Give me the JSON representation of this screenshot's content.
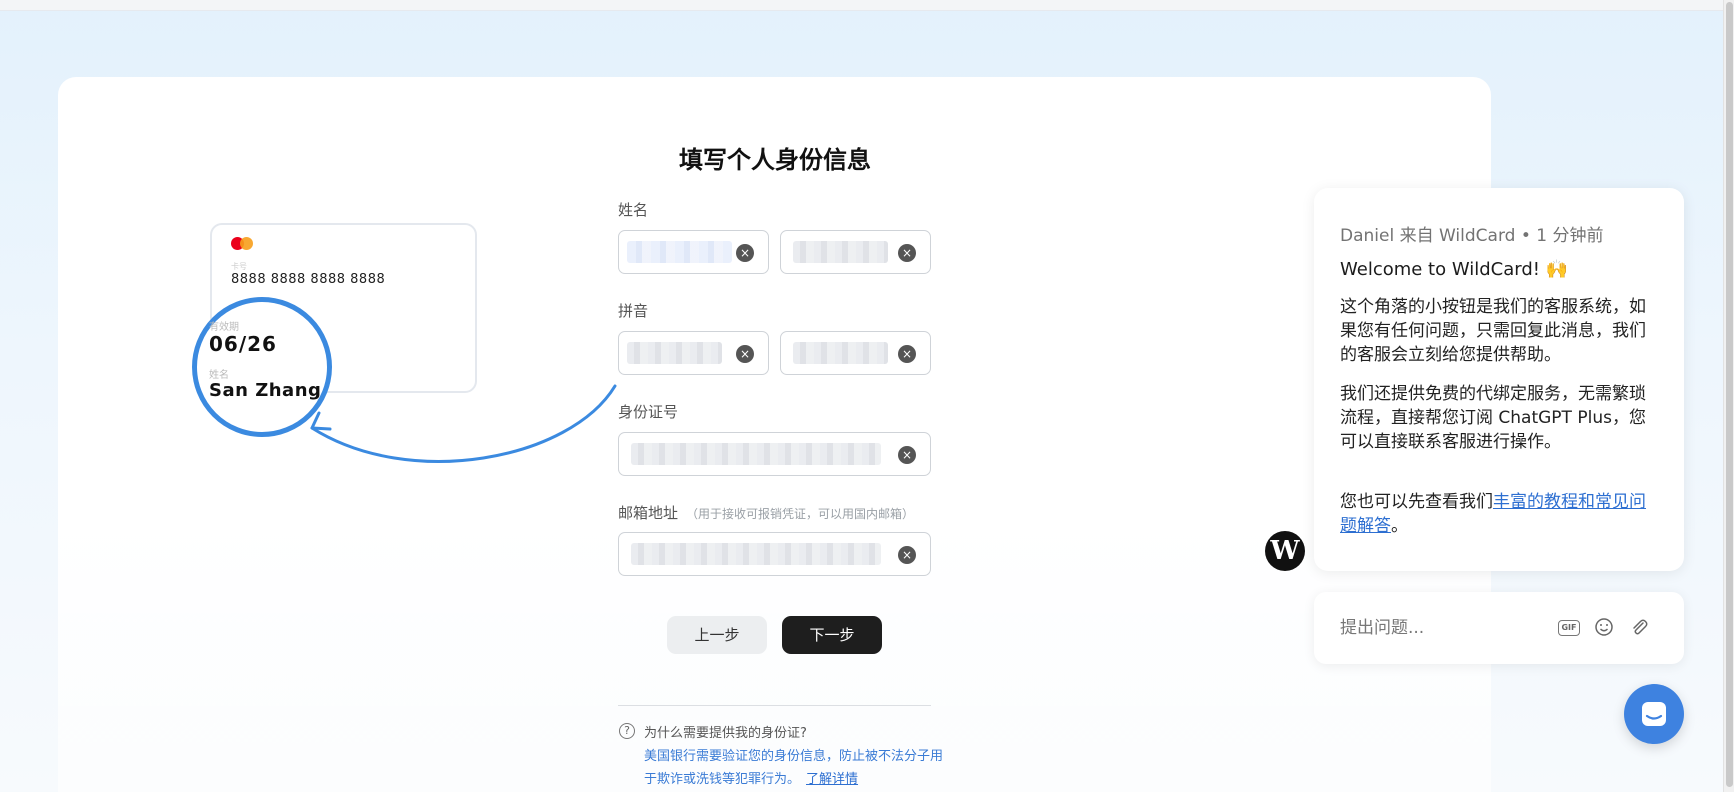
{
  "page": {
    "title": "填写个人身份信息"
  },
  "card_demo": {
    "card_number_label": "卡号",
    "card_number": "8888 8888 8888 8888",
    "expiry_label": "有效期",
    "expiry": "06/26",
    "name_label": "姓名",
    "name": "San Zhang"
  },
  "form": {
    "name_label": "姓名",
    "pinyin_label": "拼音",
    "id_label": "身份证号",
    "email_label": "邮箱地址",
    "email_hint": "（用于接收可报销凭证，可以用国内邮箱）",
    "clear_icon": "×"
  },
  "buttons": {
    "prev": "上一步",
    "next": "下一步"
  },
  "help": {
    "question": "为什么需要提供我的身份证?",
    "answer": "美国银行需要验证您的身份信息，防止被不法分子用于欺诈或洗钱等犯罪行为。",
    "link": "了解详情"
  },
  "chat": {
    "meta": "Daniel 来自 WildCard • 1 分钟前",
    "welcome": "Welcome to WildCard! 🙌",
    "p1": "这个角落的小按钮是我们的客服系统，如果您有任何问题，只需回复此消息，我们的客服会立刻给您提供帮助。",
    "p2": "我们还提供免费的代绑定服务，无需繁琐流程，直接帮您订阅 ChatGPT Plus，您可以直接联系客服进行操作。",
    "p3_prefix": "您也可以先查看我们",
    "p3_link": "丰富的教程和常见问题解答",
    "p3_suffix": "。",
    "avatar_letter": "W",
    "input_placeholder": "提出问题...",
    "gif_label": "GIF"
  },
  "colors": {
    "accent": "#3b8ae0",
    "launcher": "#3e82e0",
    "primary_button": "#1e1e1e"
  }
}
